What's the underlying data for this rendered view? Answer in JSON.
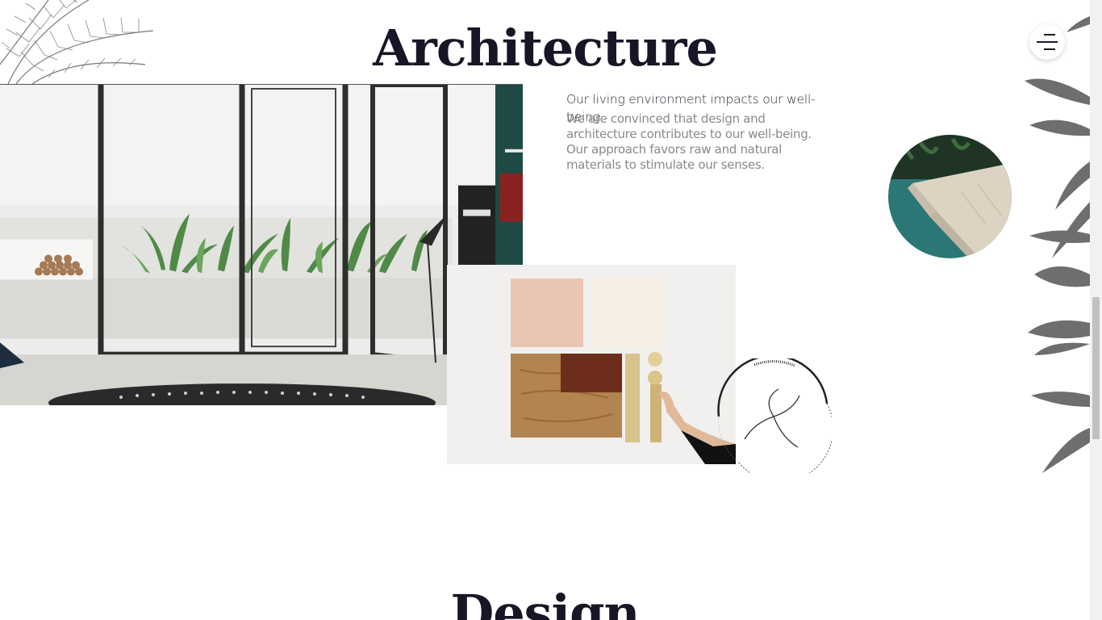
{
  "sections": {
    "architecture": {
      "title": "Architecture",
      "intro": "Our living environment impacts our well-being.",
      "body": "We are convinced that design and architecture contributes to our well-being. Our approach favors raw and natural materials to stimulate our senses."
    },
    "design": {
      "title": "Design"
    }
  },
  "menu": {
    "icon": "hamburger-menu-icon"
  },
  "images": {
    "living_room": "living-room-photo",
    "materials": "materials-moodboard-photo",
    "pool": "pool-stone-photo"
  },
  "icons": {
    "stamp": "swirl-logo-icon",
    "palm": "palm-leaves-icon",
    "leaves": "leaves-icon"
  },
  "colors": {
    "title": "#161626",
    "intro_text": "#2a2a36",
    "body_text": "#8a8a8a"
  }
}
